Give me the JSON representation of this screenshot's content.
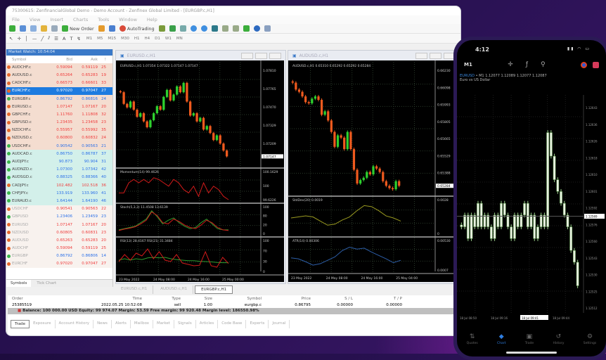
{
  "window": {
    "title": "75300615: ZenfinancialGlobal Demo - Demo Account - Zenfinex Global Limited - [EURGBP.c,H1]",
    "menu": [
      "File",
      "View",
      "Insert",
      "Charts",
      "Tools",
      "Window",
      "Help"
    ],
    "new_order": "New Order",
    "autotrading": "AutoTrading",
    "timeframes": [
      "M1",
      "M5",
      "M15",
      "M30",
      "H1",
      "H4",
      "D1",
      "W1",
      "MN"
    ]
  },
  "market_watch": {
    "title": "Market Watch: 10:54:04",
    "headers": [
      "Symbol",
      "Bid",
      "Ask",
      "!"
    ],
    "rows": [
      {
        "s": "AUDCHF.c",
        "b": "0.59094",
        "a": "0.59119",
        "sp": "25",
        "d": "down",
        "g": "a"
      },
      {
        "s": "AUDUSD.c",
        "b": "0.65264",
        "a": "0.65283",
        "sp": "19",
        "d": "down",
        "g": "a"
      },
      {
        "s": "CADCHF.c",
        "b": "0.66573",
        "a": "0.66601",
        "sp": "33",
        "d": "down",
        "g": "a"
      },
      {
        "s": "EURCHF.c",
        "b": "0.97020",
        "a": "0.97047",
        "sp": "27",
        "d": "down",
        "g": "sel"
      },
      {
        "s": "EURGBP.c",
        "b": "0.86792",
        "a": "0.86816",
        "sp": "24",
        "d": "up",
        "g": "a"
      },
      {
        "s": "EURUSD.c",
        "b": "1.07147",
        "a": "1.07167",
        "sp": "20",
        "d": "down",
        "g": "a"
      },
      {
        "s": "GBPCHF.c",
        "b": "1.11760",
        "a": "1.11808",
        "sp": "32",
        "d": "down",
        "g": "a"
      },
      {
        "s": "GBPUSD.c",
        "b": "1.23435",
        "a": "1.23458",
        "sp": "23",
        "d": "down",
        "g": "a"
      },
      {
        "s": "NZDCHF.c",
        "b": "0.55957",
        "a": "0.55992",
        "sp": "35",
        "d": "down",
        "g": "a"
      },
      {
        "s": "NZDUSD.c",
        "b": "0.60800",
        "a": "0.60832",
        "sp": "24",
        "d": "down",
        "g": "a"
      },
      {
        "s": "USDCHF.c",
        "b": "0.90542",
        "a": "0.90563",
        "sp": "21",
        "d": "up",
        "g": "a"
      },
      {
        "s": "AUDCAD.c",
        "b": "0.86750",
        "a": "0.86787",
        "sp": "37",
        "d": "up",
        "g": "b"
      },
      {
        "s": "AUDJPY.c",
        "b": "90.873",
        "a": "90.904",
        "sp": "31",
        "d": "up",
        "g": "b"
      },
      {
        "s": "AUDNZD.c",
        "b": "1.07300",
        "a": "1.07342",
        "sp": "42",
        "d": "up",
        "g": "b"
      },
      {
        "s": "AUDSGD.c",
        "b": "0.88325",
        "a": "0.88366",
        "sp": "40",
        "d": "up",
        "g": "b"
      },
      {
        "s": "CADJPY.c",
        "b": "102.482",
        "a": "102.518",
        "sp": "36",
        "d": "down",
        "g": "b"
      },
      {
        "s": "CHFJPY.c",
        "b": "133.919",
        "a": "133.960",
        "sp": "41",
        "d": "up",
        "g": "b"
      },
      {
        "s": "EURAUD.c",
        "b": "1.64144",
        "a": "1.64190",
        "sp": "46",
        "d": "up",
        "g": "b"
      },
      {
        "s": "USDCHF",
        "b": "0.90541",
        "a": "0.90563",
        "sp": "22",
        "d": "down",
        "g": "c"
      },
      {
        "s": "GBPUSD",
        "b": "1.23406",
        "a": "1.23459",
        "sp": "23",
        "d": "up",
        "g": "c"
      },
      {
        "s": "EURUSD",
        "b": "1.07147",
        "a": "1.07167",
        "sp": "20",
        "d": "down",
        "g": "c"
      },
      {
        "s": "NZDUSD",
        "b": "0.60805",
        "a": "0.60831",
        "sp": "23",
        "d": "down",
        "g": "c"
      },
      {
        "s": "AUDUSD",
        "b": "0.65263",
        "a": "0.65283",
        "sp": "20",
        "d": "down",
        "g": "c"
      },
      {
        "s": "AUDCHF",
        "b": "0.59094",
        "a": "0.59119",
        "sp": "25",
        "d": "down",
        "g": "c"
      },
      {
        "s": "EURGBP",
        "b": "0.86792",
        "a": "0.86806",
        "sp": "14",
        "d": "up",
        "g": "c"
      },
      {
        "s": "EURCHF",
        "b": "0.97020",
        "a": "0.97047",
        "sp": "27",
        "d": "down",
        "g": "c"
      }
    ],
    "tabs": [
      "Symbols",
      "Tick Chart"
    ]
  },
  "colors": {
    "up": "#2a6fe8",
    "down": "#ef3b3b",
    "bull": "#2ed12e",
    "bear": "#f05a1e",
    "selected": "#1d7be0"
  },
  "chart_tabs": [
    "EURUSD.c,H1",
    "AUDUSD.c,H1",
    "EURGBP.c,H1"
  ],
  "chart_data": [
    {
      "type": "candlestick",
      "title": "EURUSD.c,H1",
      "header": "EURUSD.c,H1  1.07354 1.07322 1.07147 1.07147",
      "ylim": [
        1.0708,
        1.079
      ],
      "yticks": [
        "1.07810",
        "1.07765",
        "1.07470",
        "1.07329",
        "1.07209"
      ],
      "current": "1.07147",
      "closes": [
        1.077,
        1.076,
        1.0757,
        1.0762,
        1.0755,
        1.0749,
        1.0752,
        1.0745,
        1.074,
        1.0746,
        1.0752,
        1.0758,
        1.0755,
        1.0766,
        1.0772,
        1.0763,
        1.0768,
        1.0775,
        1.077,
        1.0778,
        1.0762,
        1.075,
        1.0752,
        1.0745,
        1.0748,
        1.0738,
        1.0741,
        1.0735,
        1.0729,
        1.0733,
        1.0726,
        1.072,
        1.0715
      ],
      "xticks": [
        "23 May 2022",
        "24 May 08:00",
        "24 May 16:00",
        "25 May 00:00"
      ],
      "indicators": [
        {
          "label": "Momentum(14) 99.4626",
          "yticks": [
            "100.1629",
            "100",
            "99.6226"
          ],
          "ylim": [
            99.5,
            100.25
          ],
          "lines": [
            {
              "color": "#d11a1a",
              "values": [
                99.7,
                99.7,
                100.0,
                100.1,
                100.0,
                100.1,
                100.0,
                100.15,
                100.1,
                100.0,
                99.9,
                100.1,
                100.0,
                99.8,
                99.7,
                99.9,
                99.6,
                100.0,
                99.7,
                99.9,
                99.8,
                99.6,
                99.5
              ]
            }
          ]
        },
        {
          "label": "Stoch(5,3,3) 11.4508 13.6139",
          "yticks": [
            "100",
            "80",
            "20",
            "0"
          ],
          "ylim": [
            0,
            100
          ],
          "lines": [
            {
              "color": "#2e9b2e",
              "values": [
                15,
                20,
                25,
                30,
                45,
                60,
                95,
                70,
                40,
                55,
                65,
                45,
                30,
                20,
                25,
                45,
                60,
                40,
                20,
                15,
                15
              ]
            },
            {
              "color": "#d11a1a",
              "values": [
                12,
                18,
                22,
                28,
                40,
                55,
                90,
                75,
                45,
                40,
                60,
                50,
                35,
                25,
                20,
                35,
                55,
                45,
                25,
                15,
                12
              ]
            }
          ]
        },
        {
          "label": "RSI(13) 28.4167  RSI(21) 31.3484",
          "yticks": [
            "100",
            "70",
            "30",
            "0"
          ],
          "ylim": [
            0,
            100
          ],
          "lines": [
            {
              "color": "#2e9b2e",
              "values": [
                40,
                45,
                40,
                45,
                42,
                48,
                50,
                48,
                50,
                45,
                42,
                40,
                38,
                38,
                36,
                35,
                34,
                32,
                31,
                31
              ]
            },
            {
              "color": "#d11a1a",
              "values": [
                35,
                60,
                40,
                65,
                55,
                80,
                45,
                70,
                40,
                35,
                60,
                30,
                25,
                20,
                22,
                70,
                20,
                15,
                50,
                28
              ]
            }
          ]
        }
      ]
    },
    {
      "type": "candlestick",
      "title": "AUDUSD.c,H1",
      "header": "AUDUSD.c,H1  0.65310 0.65292 0.65292 0.65284",
      "ylim": [
        0.6522,
        0.663
      ],
      "yticks": [
        "0.66230",
        "0.66098",
        "0.65993",
        "0.65805",
        "0.65665",
        "0.65529",
        "0.65388"
      ],
      "current": "0.65284",
      "closes": [
        0.6618,
        0.6612,
        0.661,
        0.6606,
        0.6601,
        0.66,
        0.6604,
        0.6606,
        0.6603,
        0.659,
        0.6593,
        0.6585,
        0.6575,
        0.6562,
        0.6572,
        0.657,
        0.656,
        0.6575,
        0.656,
        0.6542,
        0.653,
        0.6533,
        0.6535,
        0.654,
        0.6538,
        0.6545,
        0.6543,
        0.654,
        0.6532,
        0.6528,
        0.6526,
        0.6525,
        0.6532,
        0.6528
      ],
      "xticks": [
        "23 May 2022",
        "24 May 08:00",
        "24 May 16:00",
        "25 May 04:00"
      ],
      "indicators": [
        {
          "label": "StdDev(20) 0.0019",
          "yticks": [
            "0.0028",
            "0"
          ],
          "ylim": [
            0,
            0.003
          ],
          "lines": [
            {
              "color": "#9a9a20",
              "values": [
                0.0015,
                0.0016,
                0.0017,
                0.0016,
                0.0012,
                0.0008,
                0.0009,
                0.0013,
                0.0016,
                0.0022,
                0.0027,
                0.0026,
                0.0022,
                0.0017,
                0.0015,
                0.0012
              ]
            }
          ]
        },
        {
          "label": "ATR(14) 0.00306",
          "yticks": [
            "0.00530",
            "0.0007"
          ],
          "ylim": [
            0.0005,
            0.006
          ],
          "lines": [
            {
              "color": "#2d5ea8",
              "values": [
                0.003,
                0.0028,
                0.0022,
                0.0015,
                0.0018,
                0.0025,
                0.0032,
                0.0045,
                0.0052,
                0.0048,
                0.005,
                0.0042,
                0.0035,
                0.0028,
                0.002,
                0.0025
              ]
            }
          ]
        }
      ]
    },
    {
      "type": "candlestick",
      "title": "EURUSD M1",
      "ylim": [
        1.1249,
        1.1266
      ],
      "yticks": [
        "1.12643",
        "1.12636",
        "1.12626",
        "1.12618",
        "1.12610",
        "1.12601",
        "1.12592",
        "1.12576",
        "1.12560",
        "1.12543",
        "1.12530",
        "1.12525",
        "1.12512"
      ],
      "current": "1.12569",
      "closes": [
        1.1256,
        1.1257,
        1.1255,
        1.1257,
        1.1256,
        1.1258,
        1.1256,
        1.1257,
        1.1256,
        1.1255,
        1.1257,
        1.1256,
        1.1258,
        1.1257,
        1.1256,
        1.1255,
        1.1257,
        1.1256,
        1.1257,
        1.1258,
        1.1256,
        1.1257,
        1.1255,
        1.1256,
        1.1257,
        1.1256,
        1.1264,
        1.1262,
        1.126,
        1.1259,
        1.1258,
        1.1257,
        1.1256,
        1.1254,
        1.1253,
        1.1251
      ],
      "xticks": [
        "18 Jul 08:50",
        "18 Jul 09:16",
        "18 Jul 09:41",
        "18 Jul 09:44"
      ]
    }
  ],
  "terminal": {
    "headers": [
      "Order",
      "Time",
      "Type",
      "Size",
      "Symbol",
      "Price",
      "S / L",
      "T / P",
      ""
    ],
    "row": [
      "25385519",
      "2022.05.25 10:52:08",
      "sell",
      "1.00",
      "eurgbp.c",
      "0.86795",
      "0.00000",
      "0.00000",
      ""
    ],
    "balance": "Balance: 100 000.00 USD  Equity: 99 974.07  Margin: 53.59  Free margin: 99 920.48  Margin level: 186550.98%",
    "tabs": [
      "Trade",
      "Exposure",
      "Account History",
      "News",
      "Alerts",
      "Mailbox",
      "Market",
      "Signals",
      "Articles",
      "Code Base",
      "Experts",
      "Journal"
    ]
  },
  "phone": {
    "time": "4:12",
    "timeframe": "M1",
    "symbol": "EURUSD",
    "info": " • M1  1.12077 1.12089 1.12077 1.12087",
    "desc": "Euro vs US Dollar",
    "nav": [
      {
        "label": "Quotes",
        "icon": "⇅"
      },
      {
        "label": "Chart",
        "icon": "◆"
      },
      {
        "label": "Trade",
        "icon": "▣"
      },
      {
        "label": "History",
        "icon": "↺"
      },
      {
        "label": "Settings",
        "icon": "⚙"
      }
    ]
  }
}
